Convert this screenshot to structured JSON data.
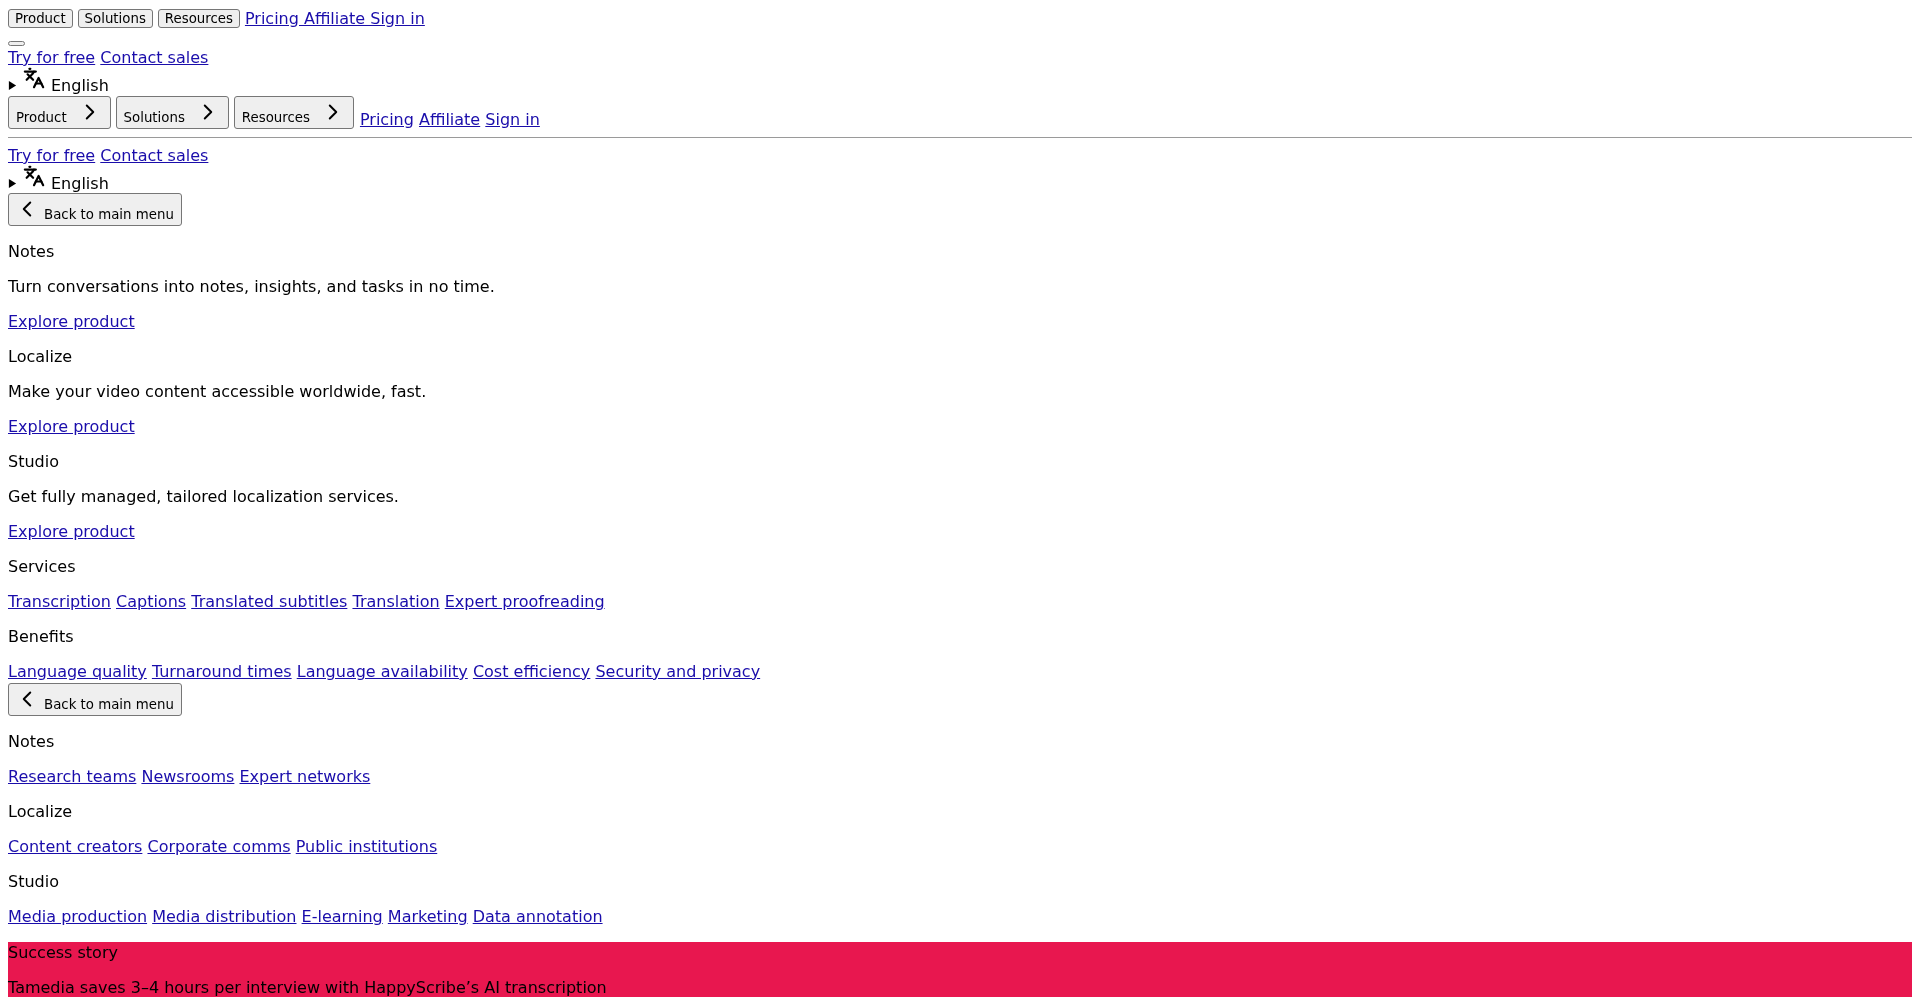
{
  "top_nav": {
    "menu_buttons": [
      "Product",
      "Solutions",
      "Resources"
    ],
    "links": "Pricing Affiliate Sign in"
  },
  "top_cta_links": [
    "Try for free",
    "Contact sales"
  ],
  "top_language": {
    "label": "English",
    "expanded": false
  },
  "main_nav": {
    "menu_buttons": [
      "Product",
      "Solutions",
      "Resources"
    ],
    "links": [
      "Pricing",
      "Affiliate",
      "Sign in"
    ]
  },
  "cta_links": [
    "Try for free",
    "Contact sales"
  ],
  "language": {
    "label": "English",
    "expanded": false
  },
  "product_menu": {
    "back_button": "Back to main menu",
    "products": [
      {
        "name": "Notes",
        "description": "Turn conversations into notes, insights, and tasks in no time.",
        "link": "Explore product"
      },
      {
        "name": "Localize",
        "description": "Make your video content accessible worldwide, fast.",
        "link": "Explore product"
      },
      {
        "name": "Studio",
        "description": "Get fully managed, tailored localization services.",
        "link": "Explore product"
      }
    ],
    "groups": [
      {
        "title": "Services",
        "links": [
          "Transcription",
          "Captions",
          "Translated subtitles",
          "Translation",
          "Expert proofreading"
        ]
      },
      {
        "title": "Benefits",
        "links": [
          "Language quality",
          "Turnaround times",
          "Language availability",
          "Cost efficiency",
          "Security and privacy"
        ]
      }
    ]
  },
  "solutions_menu": {
    "back_button": "Back to main menu",
    "groups": [
      {
        "title": "Notes",
        "links": [
          "Research teams",
          "Newsrooms",
          "Expert networks"
        ]
      },
      {
        "title": "Localize",
        "links": [
          "Content creators",
          "Corporate comms",
          "Public institutions"
        ]
      },
      {
        "title": "Studio",
        "links": [
          "Media production",
          "Media distribution",
          "E-learning",
          "Marketing",
          "Data annotation"
        ]
      }
    ]
  },
  "success_story": {
    "label": "Success story",
    "title": "Tamedia saves 3–4 hours per interview with HappyScribe’s AI transcription"
  }
}
